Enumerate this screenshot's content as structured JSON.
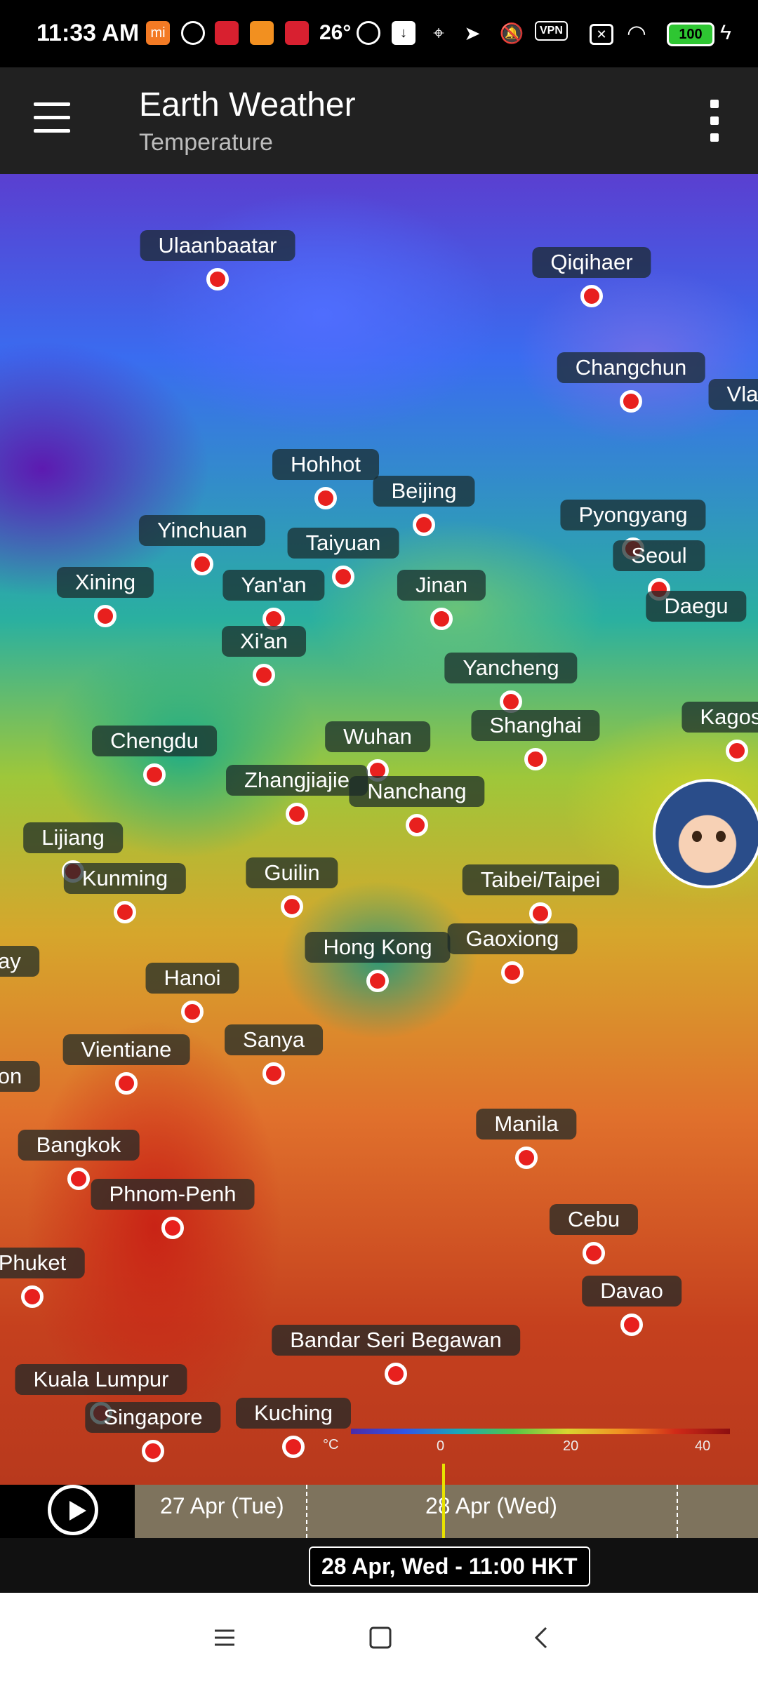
{
  "status": {
    "time": "11:33 AM",
    "temperature": "26°",
    "vpn": "VPN",
    "battery": "100",
    "icons": [
      "mi-icon",
      "nfc-icon",
      "app-icon",
      "app-icon",
      "app-icon",
      "nfc-icon",
      "download-icon",
      "location-icon",
      "send-icon",
      "mute-icon",
      "vpn-icon",
      "sim-icon",
      "wifi-icon",
      "battery-icon",
      "charging-icon"
    ]
  },
  "app": {
    "title": "Earth Weather",
    "subtitle": "Temperature"
  },
  "cities": [
    {
      "name": "Ulaanbaatar"
    },
    {
      "name": "Qiqihaer"
    },
    {
      "name": "Changchun"
    },
    {
      "name": "Vladi"
    },
    {
      "name": "Hohhot"
    },
    {
      "name": "Beijing"
    },
    {
      "name": "Pyongyang"
    },
    {
      "name": "Yinchuan"
    },
    {
      "name": "Taiyuan"
    },
    {
      "name": "Seoul"
    },
    {
      "name": "Xining"
    },
    {
      "name": "Yan'an"
    },
    {
      "name": "Jinan"
    },
    {
      "name": "Daegu"
    },
    {
      "name": "Xi'an"
    },
    {
      "name": "Yancheng"
    },
    {
      "name": "Chengdu"
    },
    {
      "name": "Wuhan"
    },
    {
      "name": "Shanghai"
    },
    {
      "name": "Kagosh"
    },
    {
      "name": "Zhangjiajie"
    },
    {
      "name": "Nanchang"
    },
    {
      "name": "Lijiang"
    },
    {
      "name": "Kunming"
    },
    {
      "name": "Guilin"
    },
    {
      "name": "Taibei/Taipei"
    },
    {
      "name": "Hong Kong"
    },
    {
      "name": "Gaoxiong"
    },
    {
      "name": "lay"
    },
    {
      "name": "Hanoi"
    },
    {
      "name": "Vientiane"
    },
    {
      "name": "Sanya"
    },
    {
      "name": "on"
    },
    {
      "name": "Manila"
    },
    {
      "name": "Bangkok"
    },
    {
      "name": "Phnom-Penh"
    },
    {
      "name": "Cebu"
    },
    {
      "name": "Phuket"
    },
    {
      "name": "Davao"
    },
    {
      "name": "Bandar Seri Begawan"
    },
    {
      "name": "Kuala Lumpur"
    },
    {
      "name": "Singapore"
    },
    {
      "name": "Kuching"
    }
  ],
  "scale": {
    "unit": "°C",
    "ticks": [
      "0",
      "20",
      "40"
    ]
  },
  "timeline": {
    "day1": "27 Apr (Tue)",
    "day2": "28 Apr (Wed)",
    "current": "28 Apr, Wed - 11:00 HKT"
  },
  "nav": [
    "menu-nav-icon",
    "home-nav-icon",
    "back-nav-icon"
  ]
}
